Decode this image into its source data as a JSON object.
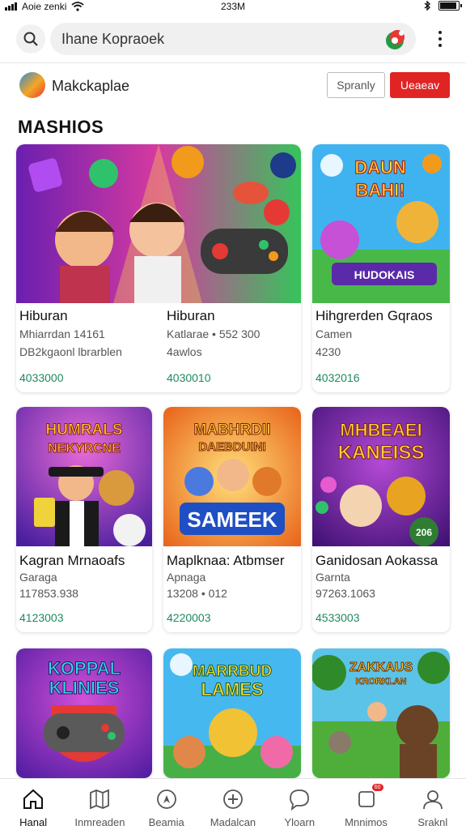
{
  "status_bar": {
    "carrier": "Aoie zenki",
    "time": "233M"
  },
  "search": {
    "value": "Ihane Kopraoek"
  },
  "marketplace": {
    "name": "Makckaplae",
    "secondary_button": "Spranly",
    "primary_button": "Ueaeav"
  },
  "section": {
    "title": "MASHIOS"
  },
  "cards": [
    {
      "title": "Hiburan",
      "line1": "Mhiarrdan 14161",
      "line2": "DB2kgaonl lbrarblen",
      "price": "4033000"
    },
    {
      "title": "Hiburan",
      "line1": "Katlarae • 552 300",
      "line2": "4awlos",
      "price": "4030010"
    },
    {
      "title": "Hihgrerden Gqraos",
      "line1": "Camen",
      "line2": "4230",
      "price": "4032016"
    },
    {
      "title": "Kagran Mrnaoafs",
      "line1": "Garaga",
      "line2": "117853.938",
      "price": "4123003",
      "art_text": [
        "HUMRALS",
        "NEKYRCNE"
      ]
    },
    {
      "title": "Maplknaa: Atbmser",
      "line1": "Apnaga",
      "line2": "13208 • 012",
      "price": "4220003",
      "art_text": [
        "MABHRDII",
        "DAEBDUINI",
        "SAMEEK"
      ]
    },
    {
      "title": "Ganidosan Aokassa",
      "line1": "Garnta",
      "line2": "97263.1063",
      "price": "4533003",
      "art_text": [
        "MHBEAEI",
        "KANEISS"
      ],
      "badge": "206"
    },
    {
      "art_text": [
        "KOPPAL",
        "KLINIES"
      ]
    },
    {
      "art_text": [
        "MARRBUD",
        "LAMES"
      ]
    },
    {
      "art_text": [
        "ZAKKAUS",
        "KRORKLAN"
      ]
    }
  ],
  "art1": [
    "DAUN",
    "BAHI!",
    "HUDOKAIS"
  ],
  "bottom_nav": [
    {
      "label": "Hanal",
      "icon": "home-icon",
      "active": true
    },
    {
      "label": "Inmreaden",
      "icon": "map-icon"
    },
    {
      "label": "Beamia",
      "icon": "compass-icon"
    },
    {
      "label": "Madalcan",
      "icon": "plus-circle-icon"
    },
    {
      "label": "Yloarn",
      "icon": "chat-icon"
    },
    {
      "label": "Mnnimos",
      "icon": "notification-icon",
      "badge": "60"
    },
    {
      "label": "Sraknl",
      "icon": "profile-icon"
    }
  ],
  "colors": {
    "accent_red": "#e02424",
    "price_green": "#1e8a5e"
  }
}
